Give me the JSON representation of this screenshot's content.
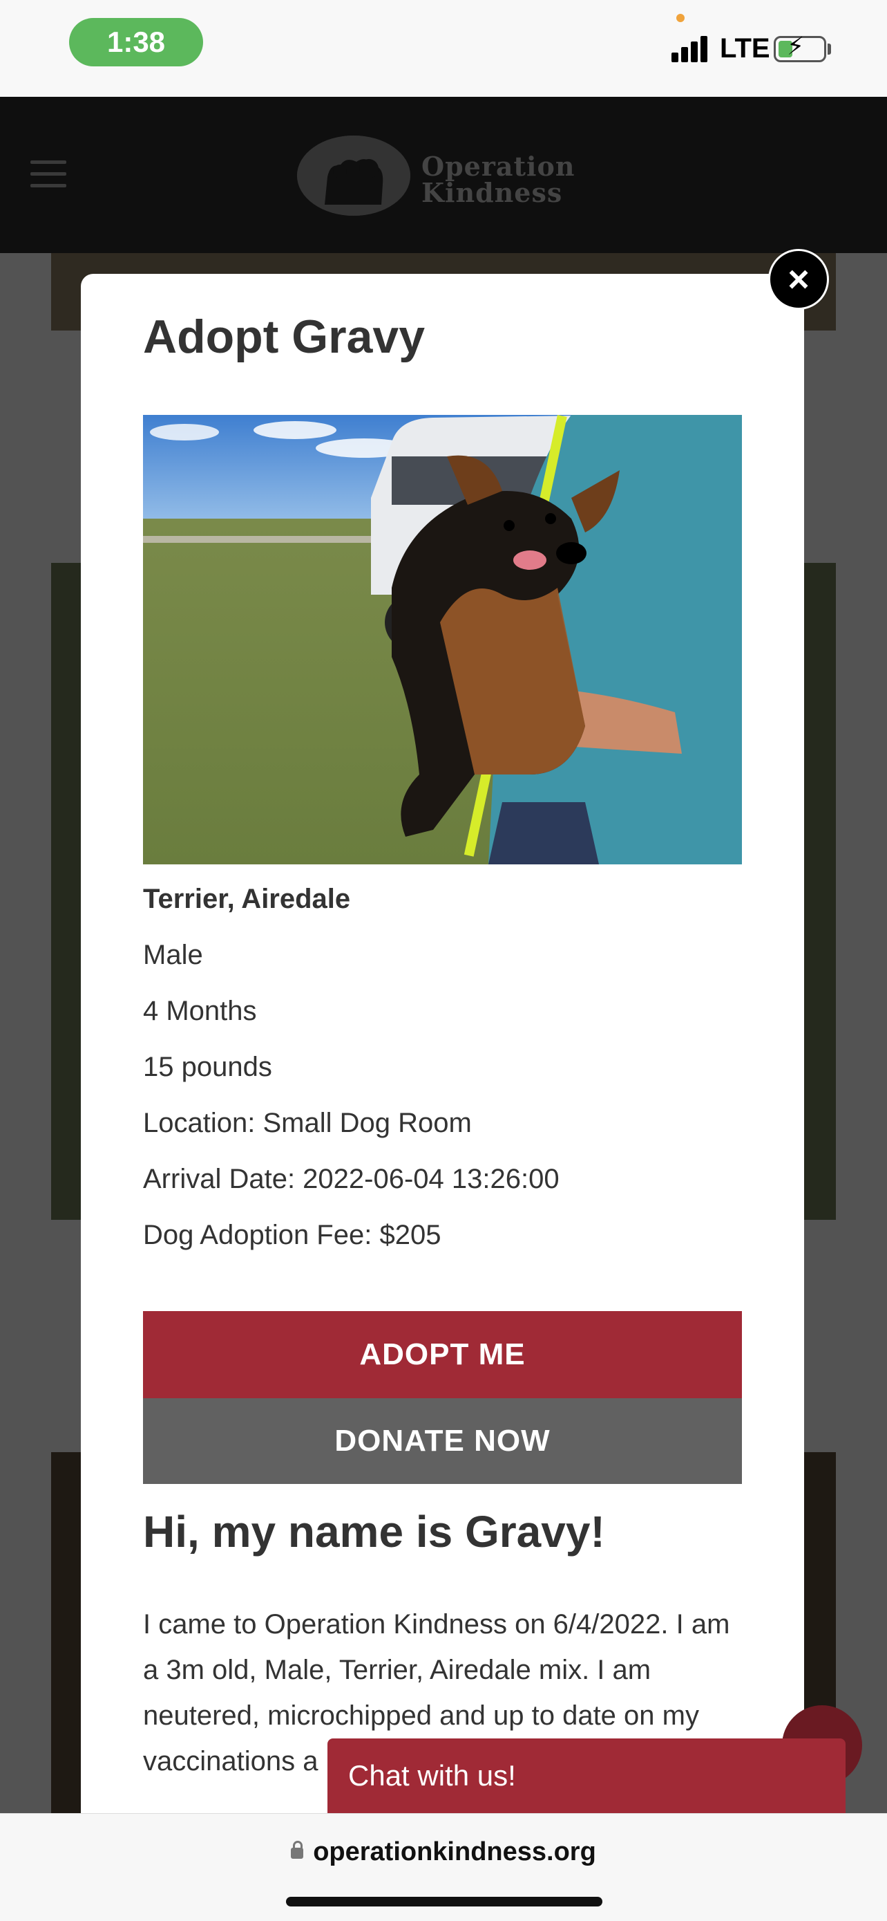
{
  "status_bar": {
    "time": "1:38",
    "network": "LTE"
  },
  "header": {
    "logo_line1": "Operation",
    "logo_line2": "Kindness"
  },
  "modal": {
    "title": "Adopt Gravy",
    "close_label": "×",
    "breed": "Terrier, Airedale",
    "sex": "Male",
    "age": "4 Months",
    "weight": "15 pounds",
    "location": "Location: Small Dog Room",
    "arrival": "Arrival Date: 2022-06-04 13:26:00",
    "fee": "Dog Adoption Fee: $205",
    "adopt_button": "ADOPT ME",
    "donate_button": "DONATE NOW",
    "greeting": "Hi, my name is Gravy!",
    "bio": "I came to Operation Kindness on 6/4/2022. I am a 3m old, Male, Terrier, Airedale mix. I am neutered, microchipped and up to date on my vaccinations a"
  },
  "chat": {
    "label": "Chat with us!"
  },
  "browser": {
    "url": "operationkindness.org"
  },
  "colors": {
    "brand_red": "#a02a36",
    "donate_gray": "#616161",
    "time_pill": "#5cb85c"
  }
}
